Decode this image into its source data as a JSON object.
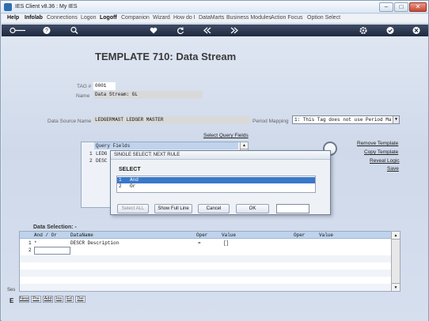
{
  "window": {
    "title": "IES Client v8.36 : My IES",
    "controls": {
      "minimize": "–",
      "maximize": "□",
      "close": "✕"
    }
  },
  "menu": {
    "items": [
      {
        "label": "Help",
        "bold": true
      },
      {
        "label": "Infolab",
        "bold": true
      },
      {
        "label": "Connections",
        "bold": false
      },
      {
        "label": "Logon",
        "bold": false
      },
      {
        "label": "Logoff",
        "bold": true
      },
      {
        "label": "Companion",
        "bold": false
      },
      {
        "label": "Wizard",
        "bold": false
      },
      {
        "label": "How do I",
        "bold": false
      },
      {
        "label": "DataMarts",
        "bold": false
      },
      {
        "label": "Business Modules",
        "bold": false
      },
      {
        "label": "Action Focus",
        "bold": false
      },
      {
        "label": "Option Select",
        "bold": false
      }
    ]
  },
  "toolbar": {
    "icons": [
      "key-icon",
      "help-icon",
      "search-icon",
      "heart-icon",
      "refresh-icon",
      "rewind-icon",
      "forward-icon",
      "gear-icon",
      "check-icon",
      "close-icon"
    ]
  },
  "page": {
    "title": "TEMPLATE 710: Data Stream",
    "tag_label": "TAG #",
    "tag_value": "0001",
    "name_label": "Name",
    "name_value": "Data Stream: GL",
    "data_source_label": "Data Source Name",
    "data_source_value": "LEDGERMAST LEDGER MASTER",
    "period_mapping_label": "Period Mapping",
    "period_mapping_value": "1: This Tag does not use Period Ma"
  },
  "links": {
    "select_query_fields": "Select Query Fields",
    "remove_template": "Remove Template",
    "copy_template": "Copy Template",
    "reveal_logic": "Reveal Logic",
    "save": "Save"
  },
  "query_fields": {
    "header": "Query Fields",
    "rows": [
      {
        "n": "1",
        "value": "LEDG"
      },
      {
        "n": "2",
        "value": "DESC"
      }
    ]
  },
  "modal": {
    "title": "SINGLE SELECT: NEXT RULE",
    "heading": "SELECT",
    "options": [
      {
        "n": "1",
        "label": "And",
        "selected": true
      },
      {
        "n": "2",
        "label": "Or",
        "selected": false
      }
    ],
    "buttons": {
      "select_all": "Select ALL",
      "show_full_line": "Show Full Line",
      "cancel": "Cancel",
      "ok": "OK"
    }
  },
  "data_selection": {
    "title": "Data Selection: -",
    "columns": [
      "And / Or",
      "DataName",
      "Oper",
      "Value",
      "Oper",
      "Value"
    ],
    "rows": [
      {
        "n": "1",
        "and_or": "*",
        "data_name": "DESCR Description",
        "oper": "=",
        "value": "[]"
      },
      {
        "n": "2",
        "and_or": "",
        "data_name": "",
        "oper": "",
        "value": ""
      }
    ]
  },
  "bottom": {
    "side_label": "Ses",
    "side_letter": "E",
    "buttons": [
      "New",
      "Pre",
      "Add",
      "Ins",
      "Ed",
      "Del"
    ]
  }
}
